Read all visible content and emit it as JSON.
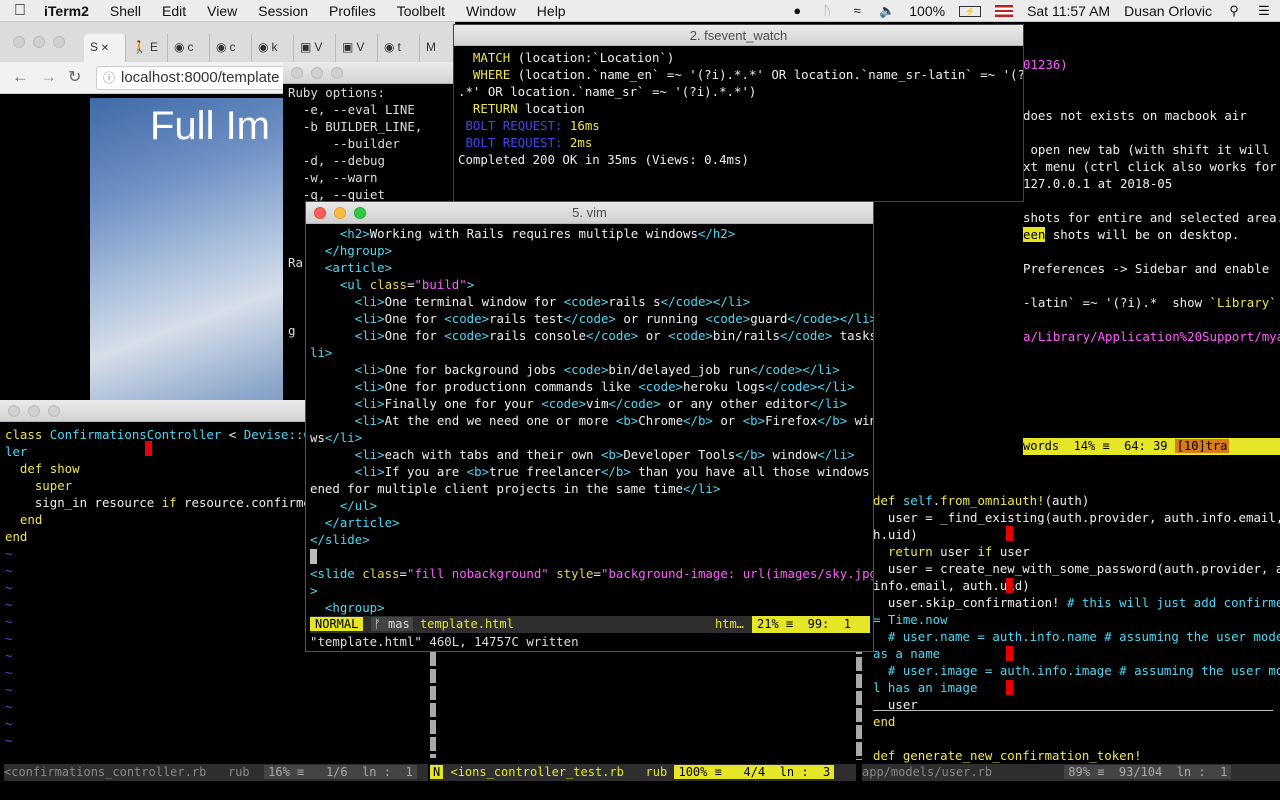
{
  "menubar": {
    "app": "iTerm2",
    "items": [
      "Shell",
      "Edit",
      "View",
      "Session",
      "Profiles",
      "Toolbelt",
      "Window",
      "Help"
    ],
    "battery": "100%",
    "clock": "Sat 11:57 AM",
    "user": "Dusan Orlovic"
  },
  "browser": {
    "tabs": [
      "S",
      "E",
      "c",
      "c",
      "k",
      "V",
      "V",
      "t",
      ""
    ],
    "url": "localhost:8000/template",
    "heading": "Full Im"
  },
  "fsevent": {
    "title": "2. fsevent_watch",
    "lines": [
      [
        [
          "  MATCH ",
          "yellow"
        ],
        [
          "(location:`Location`)",
          "white"
        ]
      ],
      [
        [
          "  WHERE ",
          "yellow"
        ],
        [
          "(location.`name_en` =~ '(?i).*.*' OR location.`name_sr-latin` =~ '(?i).*",
          "white"
        ]
      ],
      [
        [
          ".*' OR location.`name_sr` =~ '(?i).*.*')",
          "white"
        ]
      ],
      [
        [
          "  RETURN ",
          "yellow"
        ],
        [
          "location",
          "white"
        ]
      ],
      [
        [
          " BOLT REQUEST: ",
          "blue"
        ],
        [
          "16ms",
          "yellow"
        ]
      ],
      [
        [
          " BOLT REQUEST: ",
          "blue"
        ],
        [
          "2ms",
          "yellow"
        ]
      ],
      [
        [
          "Completed 200 OK in 35ms (Views: 0.4ms)",
          "white"
        ]
      ]
    ]
  },
  "ruby": {
    "lines": [
      "Ruby options:",
      "  -e, --eval LINE",
      "  -b BUILDER_LINE,",
      "      --builder",
      "  -d, --debug",
      "  -w, --warn",
      "  -q, --quiet",
      "",
      "",
      "",
      "Ra",
      "",
      "",
      "",
      "g"
    ]
  },
  "rightpane": {
    "lines": [
      [
        [
          "",
          "white"
        ]
      ],
      [
        [
          "",
          "white"
        ]
      ],
      [
        [
          "01236)",
          "mag"
        ]
      ],
      [
        [
          "",
          "white"
        ]
      ],
      [
        [
          "",
          "white"
        ]
      ],
      [
        [
          "does not exists on macbook air",
          "white"
        ]
      ],
      [
        [
          "",
          "white"
        ]
      ],
      [
        [
          " open new tab (with shift it will",
          "white"
        ]
      ],
      [
        [
          "xt menu (ctrl click also works for",
          "white"
        ]
      ],
      [
        [
          "127.0.0.1 at 2018-05",
          "white"
        ]
      ],
      [
        [
          "",
          "white"
        ]
      ],
      [
        [
          "shots for entire and selected area.",
          "white"
        ]
      ],
      [
        [
          "een",
          "hl"
        ],
        [
          " shots will be on desktop.",
          "white"
        ]
      ],
      [
        [
          "",
          "white"
        ]
      ],
      [
        [
          "Preferences -> Sidebar and enable",
          "white"
        ]
      ],
      [
        [
          "",
          "white"
        ]
      ],
      [
        [
          "-latin` =~ '(?i).*",
          "white"
        ],
        [
          "  show `",
          "white"
        ],
        [
          "Library",
          "yellow"
        ],
        [
          "` folder. Some app",
          "white"
        ]
      ],
      [
        [
          "",
          "white"
        ]
      ],
      [
        [
          "a/Library/Application%20Support/myap",
          "mag"
        ]
      ]
    ],
    "status": {
      "words": "words",
      "pct": "14%",
      "pos": "64: 39",
      "extra": "[10]tra"
    }
  },
  "user_rb": {
    "lines": [
      [
        [
          "def ",
          "kw"
        ],
        [
          "self",
          "cyan"
        ],
        [
          ".",
          "white"
        ],
        [
          "from_omniauth!",
          "yellow"
        ],
        [
          "(auth)",
          "white"
        ]
      ],
      [
        [
          "  user = _find_existing(auth.provider, auth.info.email, a",
          "white"
        ]
      ],
      [
        [
          "h.uid)",
          "white"
        ]
      ],
      [
        [
          "  return ",
          "kw"
        ],
        [
          "user ",
          "white"
        ],
        [
          "if ",
          "kw"
        ],
        [
          "user",
          "white"
        ]
      ],
      [
        [
          "  user = create_new_with_some_password(auth.provider, aut",
          "white"
        ]
      ],
      [
        [
          "info.email, auth.uid)",
          "white"
        ]
      ],
      [
        [
          "  user.skip_confirmation! ",
          "white"
        ],
        [
          "# this will just add confirmed_",
          "cyan"
        ]
      ],
      [
        [
          "= Time.now",
          "cyan"
        ]
      ],
      [
        [
          "  # user.name = auth.info.name # assuming the user model",
          "cyan"
        ]
      ],
      [
        [
          "as a name",
          "cyan"
        ]
      ],
      [
        [
          "  # user.image = auth.info.image # assuming the user mode",
          "cyan"
        ]
      ],
      [
        [
          "l has an image",
          "cyan"
        ]
      ],
      [
        [
          "  user",
          "white"
        ]
      ],
      [
        [
          "end",
          "kw"
        ]
      ],
      [
        [
          "",
          "white"
        ]
      ],
      [
        [
          "def ",
          "kw"
        ],
        [
          "generate_new_confirmation_token!",
          "yellow"
        ]
      ]
    ],
    "status": {
      "file": "app/models/user.rb",
      "pct": "89%",
      "pos": "93/104",
      "ln": "ln :",
      "col": "1"
    }
  },
  "confirm": {
    "lines": [
      [
        [
          "class ",
          "kw"
        ],
        [
          "ConfirmationsController",
          "cyan"
        ],
        [
          " < ",
          "white"
        ],
        [
          "Devise::Con",
          "cyan"
        ]
      ],
      [
        [
          "ler",
          "cyan"
        ]
      ],
      [
        [
          "  def ",
          "kw"
        ],
        [
          "show",
          "yellow"
        ]
      ],
      [
        [
          "    super",
          "kw"
        ]
      ],
      [
        [
          "    sign_in resource ",
          "white"
        ],
        [
          "if ",
          "kw"
        ],
        [
          "resource.confirmed?",
          "white"
        ]
      ],
      [
        [
          "  end",
          "kw"
        ]
      ],
      [
        [
          "end",
          "kw"
        ]
      ]
    ],
    "tildes": 12,
    "status": {
      "file": "<confirmations_controller.rb",
      "type": "rub",
      "pct": "16%",
      "pos": "1/6",
      "ln": "ln :",
      "col": "1"
    }
  },
  "test_pane": {
    "status": {
      "mode": "N",
      "file": "<ions_controller_test.rb",
      "type": "rub",
      "pct": "100%",
      "pos": "4/4",
      "ln": "ln :",
      "col": "3"
    }
  },
  "vim": {
    "title": "5. vim",
    "lines": [
      [
        [
          "    <h2>",
          "tag"
        ],
        [
          "Working with Rails requires multiple windows",
          "white"
        ],
        [
          "</h2>",
          "tag"
        ]
      ],
      [
        [
          "  </hgroup>",
          "tag"
        ]
      ],
      [
        [
          "  <article>",
          "tag"
        ]
      ],
      [
        [
          "    <ul ",
          "tag"
        ],
        [
          "class",
          "attr"
        ],
        [
          "=",
          "white"
        ],
        [
          "\"build\"",
          "str"
        ],
        [
          ">",
          "tag"
        ]
      ],
      [
        [
          "      <li>",
          "tag"
        ],
        [
          "One terminal window for ",
          "white"
        ],
        [
          "<code>",
          "tag"
        ],
        [
          "rails s",
          "white"
        ],
        [
          "</code></li>",
          "tag"
        ]
      ],
      [
        [
          "      <li>",
          "tag"
        ],
        [
          "One for ",
          "white"
        ],
        [
          "<code>",
          "tag"
        ],
        [
          "rails test",
          "white"
        ],
        [
          "</code>",
          "tag"
        ],
        [
          " or running ",
          "white"
        ],
        [
          "<code>",
          "tag"
        ],
        [
          "guard",
          "white"
        ],
        [
          "</code></li>",
          "tag"
        ]
      ],
      [
        [
          "      <li>",
          "tag"
        ],
        [
          "One for ",
          "white"
        ],
        [
          "<code>",
          "tag"
        ],
        [
          "rails console",
          "white"
        ],
        [
          "</code>",
          "tag"
        ],
        [
          " or ",
          "white"
        ],
        [
          "<code>",
          "tag"
        ],
        [
          "bin/rails",
          "white"
        ],
        [
          "</code>",
          "tag"
        ],
        [
          " tasks",
          "white"
        ],
        [
          "</",
          "tag"
        ]
      ],
      [
        [
          "li>",
          "tag"
        ]
      ],
      [
        [
          "      <li>",
          "tag"
        ],
        [
          "One for background jobs ",
          "white"
        ],
        [
          "<code>",
          "tag"
        ],
        [
          "bin/delayed_job run",
          "white"
        ],
        [
          "</code></li>",
          "tag"
        ]
      ],
      [
        [
          "      <li>",
          "tag"
        ],
        [
          "One for productionn commands like ",
          "white"
        ],
        [
          "<code>",
          "tag"
        ],
        [
          "heroku logs",
          "white"
        ],
        [
          "</code></li>",
          "tag"
        ]
      ],
      [
        [
          "      <li>",
          "tag"
        ],
        [
          "Finally one for your ",
          "white"
        ],
        [
          "<code>",
          "tag"
        ],
        [
          "vim",
          "white"
        ],
        [
          "</code>",
          "tag"
        ],
        [
          " or any other editor",
          "white"
        ],
        [
          "</li>",
          "tag"
        ]
      ],
      [
        [
          "      <li>",
          "tag"
        ],
        [
          "At the end we need one or more ",
          "white"
        ],
        [
          "<b>",
          "tag"
        ],
        [
          "Chrome",
          "white"
        ],
        [
          "</b>",
          "tag"
        ],
        [
          " or ",
          "white"
        ],
        [
          "<b>",
          "tag"
        ],
        [
          "Firefox",
          "white"
        ],
        [
          "</b>",
          "tag"
        ],
        [
          " windo",
          "white"
        ]
      ],
      [
        [
          "ws",
          "white"
        ],
        [
          "</li>",
          "tag"
        ]
      ],
      [
        [
          "      <li>",
          "tag"
        ],
        [
          "each with tabs and their own ",
          "white"
        ],
        [
          "<b>",
          "tag"
        ],
        [
          "Developer Tools",
          "white"
        ],
        [
          "</b>",
          "tag"
        ],
        [
          " window",
          "white"
        ],
        [
          "</li>",
          "tag"
        ]
      ],
      [
        [
          "      <li>",
          "tag"
        ],
        [
          "If you are ",
          "white"
        ],
        [
          "<b>",
          "tag"
        ],
        [
          "true freelancer",
          "white"
        ],
        [
          "</b>",
          "tag"
        ],
        [
          " than you have all those windows op",
          "white"
        ]
      ],
      [
        [
          "ened for multiple client projects in the same time",
          "white"
        ],
        [
          "</li>",
          "tag"
        ]
      ],
      [
        [
          "    </ul>",
          "tag"
        ]
      ],
      [
        [
          "  </article>",
          "tag"
        ]
      ],
      [
        [
          "</slide>",
          "tag"
        ]
      ],
      [
        [
          "",
          "white"
        ]
      ],
      [
        [
          "<slide ",
          "tag"
        ],
        [
          "class",
          "attr"
        ],
        [
          "=",
          "white"
        ],
        [
          "\"fill nobackground\"",
          "str"
        ],
        [
          " style",
          "attr"
        ],
        [
          "=",
          "white"
        ],
        [
          "\"background-image: url(images/sky.jpg)\"",
          "str"
        ]
      ],
      [
        [
          ">",
          "tag"
        ]
      ],
      [
        [
          "  <hgroup>",
          "tag"
        ]
      ]
    ],
    "status": {
      "mode": "NORMAL",
      "branch": "ᚠ mas",
      "file": "template.html",
      "type": "htm…",
      "pct": "21%",
      "pos": "99:",
      "col": "1"
    },
    "message": "\"template.html\" 460L, 14757C written"
  }
}
